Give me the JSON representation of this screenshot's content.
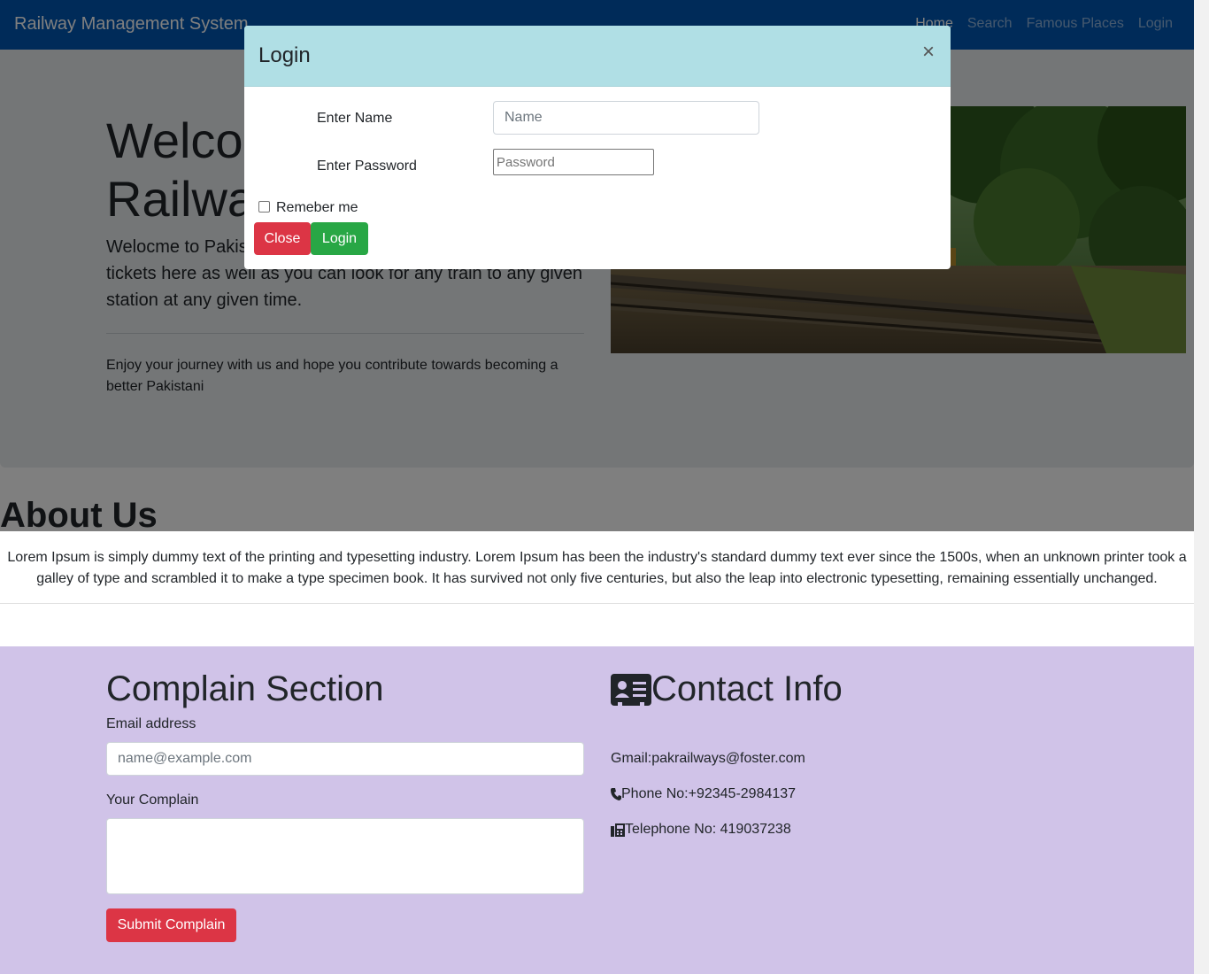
{
  "navbar": {
    "brand": "Railway Management System",
    "links": [
      "Home",
      "Search",
      "Famous Places",
      "Login"
    ]
  },
  "jumbotron": {
    "title": "Welcome to Pakistan Railways",
    "lead": "Welocme to Pakistan Railways. You can book your advance tickets here as well as you can look for any train to any given station at any given time.",
    "text": "Enjoy your journey with us and hope you contribute towards becoming a better Pakistani"
  },
  "about": {
    "title": "About Us",
    "text": "Lorem Ipsum is simply dummy text of the printing and typesetting industry. Lorem Ipsum has been the industry's standard dummy text ever since the 1500s, when an unknown printer took a galley of type and scrambled it to make a type specimen book. It has survived not only five centuries, but also the leap into electronic typesetting, remaining essentially unchanged."
  },
  "complain": {
    "title": "Complain Section",
    "email_label": "Email address",
    "email_placeholder": "name@example.com",
    "complain_label": "Your Complain",
    "submit_label": "Submit Complain"
  },
  "contact": {
    "title": "Contact Info",
    "gmail": "Gmail:pakrailways@foster.com",
    "phone": "Phone No:+92345-2984137",
    "telephone": "Telephone No: 419037238"
  },
  "login_modal": {
    "title": "Login",
    "close_glyph": "×",
    "name_label": "Enter Name",
    "name_placeholder": "Name",
    "password_label": "Enter Password",
    "password_placeholder": "Password",
    "remember_label": "Remeber me",
    "close_button": "Close",
    "login_button": "Login"
  },
  "colors": {
    "navbar": "#0056b3",
    "modal_header": "#b0dfe5",
    "purple_section": "#d0c3e8",
    "danger": "#dc3545",
    "success": "#28a745"
  }
}
